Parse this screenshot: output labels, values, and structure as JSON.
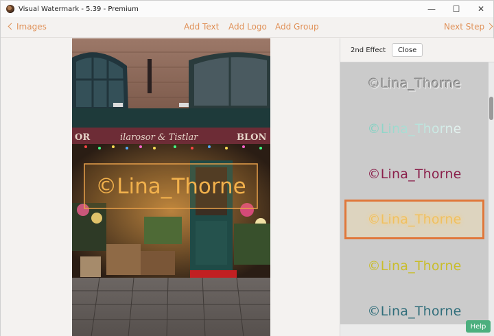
{
  "window": {
    "title": "Visual Watermark - 5.39 - Premium",
    "minimize": "—",
    "maximize": "☐",
    "close": "✕"
  },
  "toolbar": {
    "back_label": "Images",
    "add_text": "Add Text",
    "add_logo": "Add Logo",
    "add_group": "Add Group",
    "next_label": "Next Step"
  },
  "preview": {
    "shop_sign": "ilarosor & Tistlar",
    "sign_left": "OR",
    "sign_right": "BLON",
    "watermark_text": "©Lina_Thorne"
  },
  "panel": {
    "label": "2nd Effect",
    "close_label": "Close",
    "effects": [
      {
        "text": "©Lina_Thorne",
        "color": "#a9a9a9",
        "style": "emboss"
      },
      {
        "text": "©Lina_Thorne",
        "color": "#7fcfc0",
        "style": "gradient"
      },
      {
        "text": "©Lina_Thorne",
        "color": "#8a1f4a",
        "style": "plain"
      },
      {
        "text": "©Lina_Thorne",
        "color": "#f0c060",
        "style": "glow",
        "selected": true
      },
      {
        "text": "©Lina_Thorne",
        "color": "#c9bd2a",
        "style": "plain"
      },
      {
        "text": "©Lina_Thorne",
        "color": "#2f6d7a",
        "style": "plain"
      }
    ]
  },
  "help_label": "Help",
  "colors": {
    "accent": "#e09158",
    "selection": "#e0773a",
    "help": "#4caf7e"
  }
}
